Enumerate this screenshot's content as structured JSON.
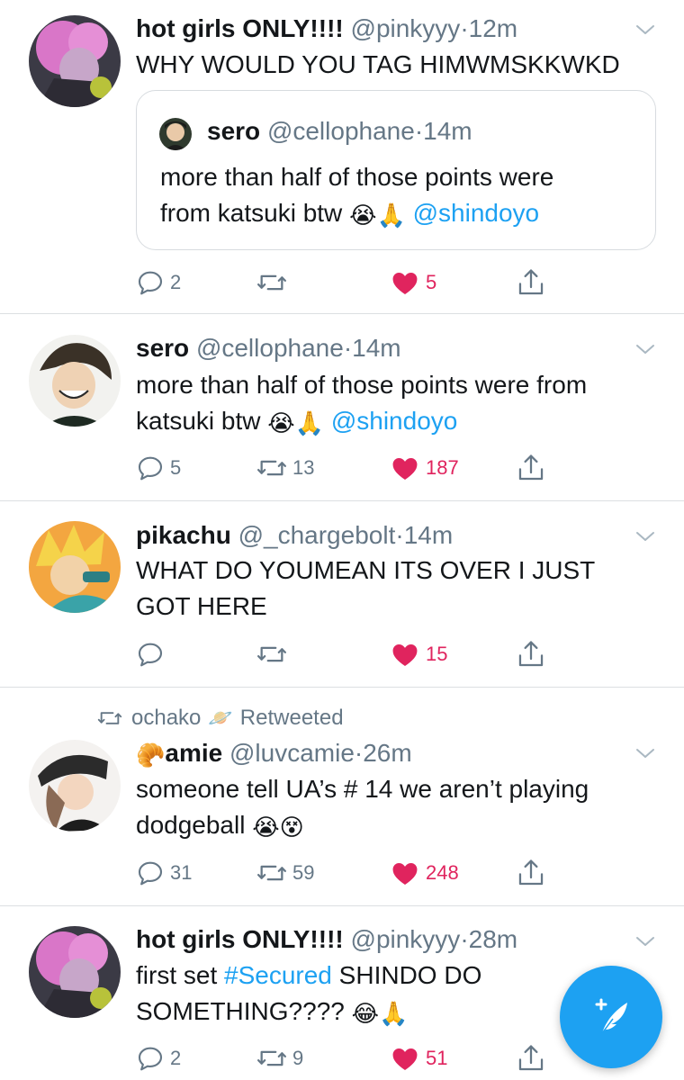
{
  "tweets": [
    {
      "name": "hot girls ONLY!!!!",
      "handle": "@pinkyyy",
      "dot": "·",
      "time": "12m",
      "text": "WHY WOULD YOU TAG HIMWMSKKWKD",
      "quote": {
        "name": "sero",
        "handle": "@cellophane",
        "dot": "·",
        "time": "14m",
        "text_line1": "more than half of those points were",
        "text_line2": "from katsuki btw",
        "emoji1": "😭",
        "emoji2": "🙏",
        "mention": "@shindoyo"
      },
      "replies": "2",
      "retweets": "",
      "likes": "5"
    },
    {
      "name": "sero",
      "handle": "@cellophane",
      "dot": "·",
      "time": "14m",
      "text_line1": "more than half of those points were from",
      "text_line2": "katsuki btw",
      "emoji1": "😭",
      "emoji2": "🙏",
      "mention": "@shindoyo",
      "replies": "5",
      "retweets": "13",
      "likes": "187"
    },
    {
      "name": "pikachu",
      "handle": "@_chargebolt",
      "dot": "·",
      "time": "14m",
      "text_line1": "WHAT DO YOUMEAN ITS OVER I JUST",
      "text_line2": "GOT HERE",
      "replies": "",
      "retweets": "",
      "likes": "15"
    },
    {
      "retweeted_by": "ochako",
      "retweeted_by_emoji": "🪐",
      "retweeted_label": "Retweeted",
      "name_emoji": "🥐",
      "name": "amie",
      "handle": "@luvcamie",
      "dot": "·",
      "time": "26m",
      "text_line1": "someone tell UA’s # 14 we aren’t playing",
      "text_line2": "dodgeball",
      "emoji1": "😭",
      "emoji2": "😵",
      "replies": "31",
      "retweets": "59",
      "likes": "248"
    },
    {
      "name": "hot girls ONLY!!!!",
      "handle": "@pinkyyy",
      "dot": "·",
      "time": "28m",
      "text_pre": "first set ",
      "hashtag": "#Secured",
      "text_post": " SHINDO DO",
      "text_line2": "SOMETHING????",
      "emoji1": "😂",
      "emoji2": "🙏",
      "replies": "2",
      "retweets": "9",
      "likes": "51"
    }
  ],
  "colors": {
    "accent": "#1da1f2",
    "like": "#e0245e",
    "muted": "#657786",
    "text": "#14171a",
    "divider": "#dcdfe2"
  },
  "icons": {
    "reply": "reply-icon",
    "retweet": "retweet-icon",
    "like": "heart-icon",
    "share": "share-icon",
    "more": "chevron-down-icon",
    "compose": "compose-tweet-icon"
  }
}
